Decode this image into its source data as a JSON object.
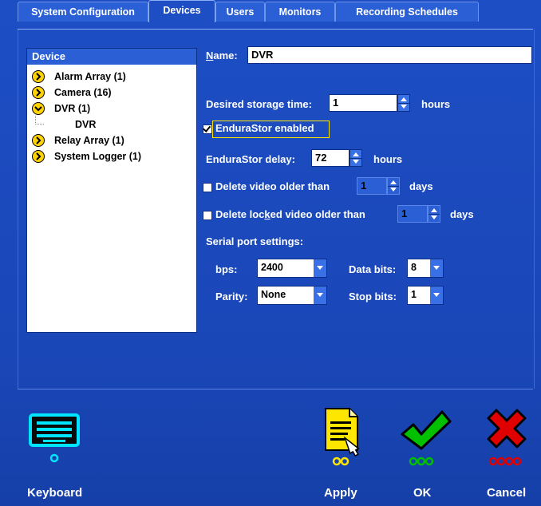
{
  "tabs": [
    {
      "label": "System Configuration",
      "active": false
    },
    {
      "label": "Devices",
      "active": true
    },
    {
      "label": "Users",
      "active": false
    },
    {
      "label": "Monitors",
      "active": false
    },
    {
      "label": "Recording Schedules",
      "active": false
    }
  ],
  "tree": {
    "header": "Device",
    "items": [
      {
        "label": "Alarm Array (1)"
      },
      {
        "label": "Camera (16)"
      },
      {
        "label": "DVR (1)",
        "children": [
          "DVR"
        ]
      },
      {
        "label": "Relay Array (1)"
      },
      {
        "label": "System Logger (1)"
      }
    ]
  },
  "form": {
    "name_label_prefix": "N",
    "name_label_rest": "ame:",
    "name_value": "DVR",
    "storage_label": "Desired storage time:",
    "storage_value": "1",
    "storage_unit": "hours",
    "endurastor_label": "EnduraStor enabled",
    "endurastor_checked": true,
    "delay_label": "EnduraStor delay:",
    "delay_value": "72",
    "delay_unit": "hours",
    "delete_old_label": "Delete video older than",
    "delete_old_value": "1",
    "delete_old_unit": "days",
    "delete_locked_label_a": "Delete loc",
    "delete_locked_label_u": "k",
    "delete_locked_label_b": "ed video older than",
    "delete_locked_value": "1",
    "delete_locked_unit": "days",
    "serial_header": "Serial port settings:",
    "bps_label": "bps:",
    "bps_value": "2400",
    "databits_label": "Data bits:",
    "databits_value": "8",
    "parity_label": "Parity:",
    "parity_value": "None",
    "stopbits_label": "Stop bits:",
    "stopbits_value": "1"
  },
  "buttons": {
    "keyboard": "Keyboard",
    "apply": "Apply",
    "ok": "OK",
    "cancel": "Cancel"
  },
  "colors": {
    "background": "#1a47b8",
    "accent_yellow": "#ffe600",
    "ok_green": "#00c000",
    "cancel_red": "#e00000",
    "keyboard_cyan": "#00e5ff"
  }
}
